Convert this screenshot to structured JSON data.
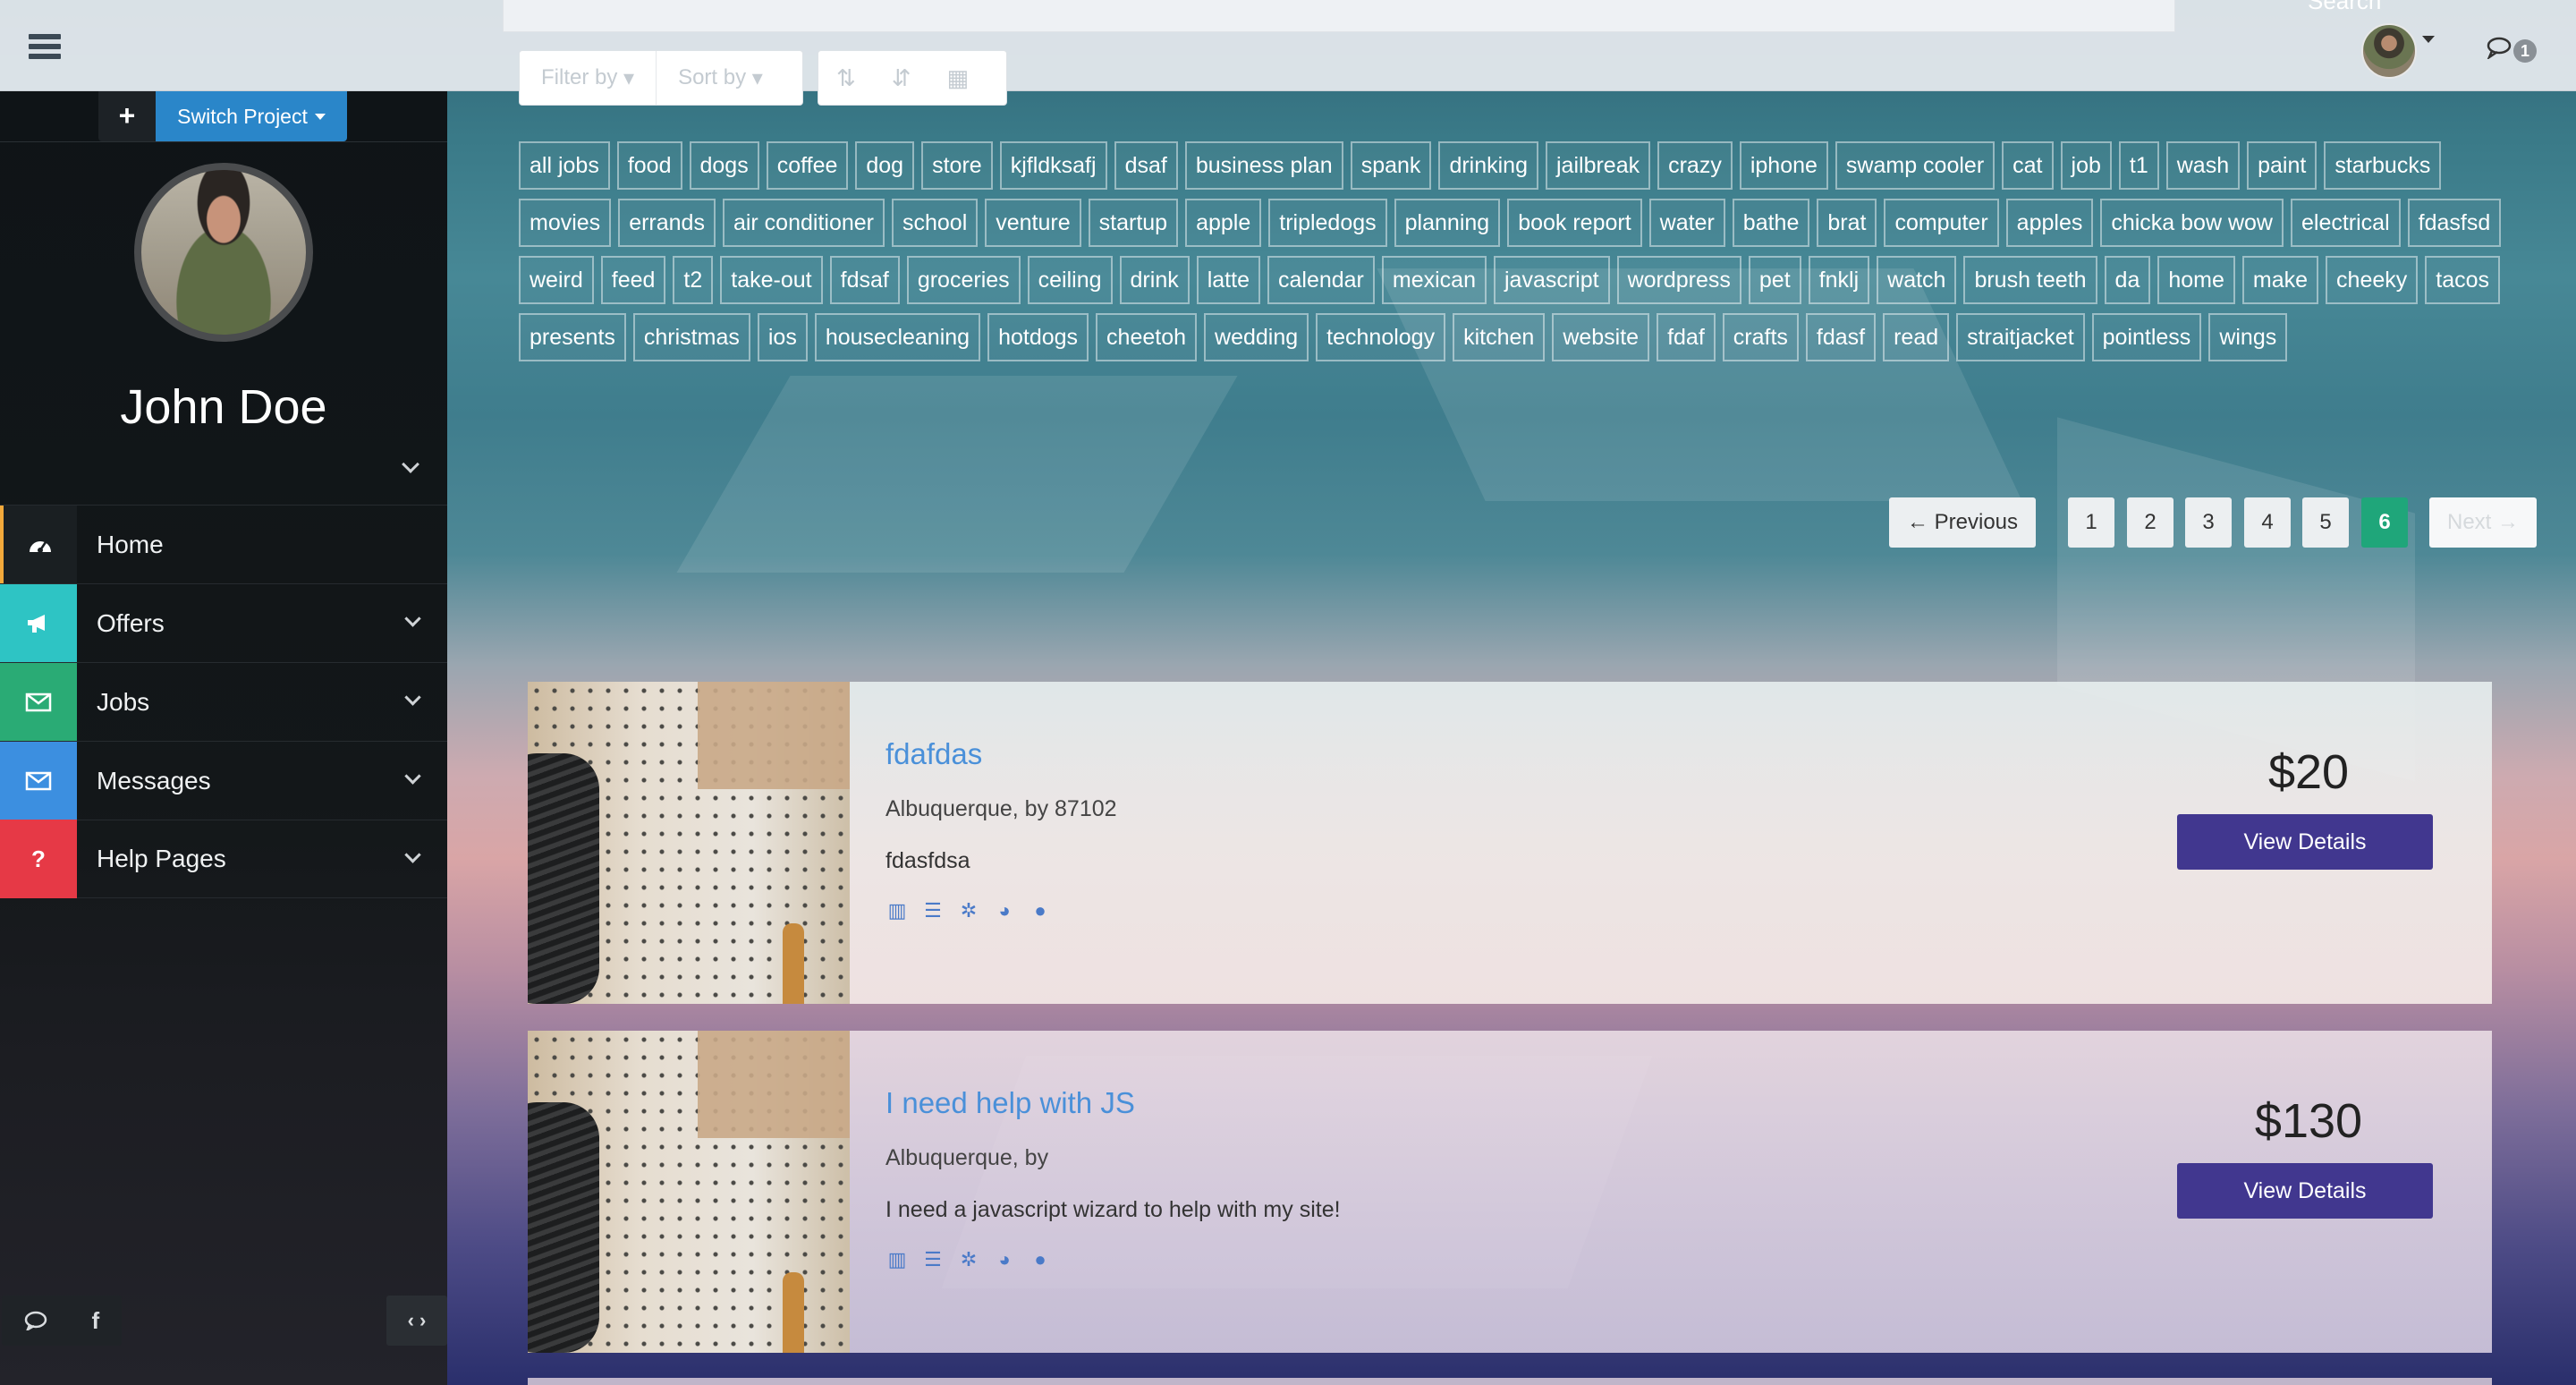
{
  "header": {
    "search_label": "Search",
    "filter_label": "Filter by",
    "sort_label": "Sort by",
    "notification_count": "1"
  },
  "sidebar": {
    "add_label": "+",
    "switch_project_label": "Switch Project",
    "user_name": "John Doe",
    "nav": [
      {
        "label": "Home",
        "icon": "dashboard-icon",
        "color": "#1a1f22",
        "accent": "#f2a93b"
      },
      {
        "label": "Offers",
        "icon": "bullhorn-icon",
        "color": "#2ec4c4"
      },
      {
        "label": "Jobs",
        "icon": "envelope-icon",
        "color": "#2aab75"
      },
      {
        "label": "Messages",
        "icon": "envelope-icon",
        "color": "#3c8fe0"
      },
      {
        "label": "Help Pages",
        "icon": "question-icon",
        "color": "#e63946"
      }
    ]
  },
  "tags": [
    "all jobs",
    "food",
    "dogs",
    "coffee",
    "dog",
    "store",
    "kjfldksafj",
    "dsaf",
    "business plan",
    "spank",
    "drinking",
    "jailbreak",
    "crazy",
    "iphone",
    "swamp cooler",
    "cat",
    "job",
    "t1",
    "wash",
    "paint",
    "starbucks",
    "movies",
    "errands",
    "air conditioner",
    "school",
    "venture",
    "startup",
    "apple",
    "tripledogs",
    "planning",
    "book report",
    "water",
    "bathe",
    "brat",
    "computer",
    "apples",
    "chicka bow wow",
    "electrical",
    "fdasfsd",
    "weird",
    "feed",
    "t2",
    "take-out",
    "fdsaf",
    "groceries",
    "ceiling",
    "drink",
    "latte",
    "calendar",
    "mexican",
    "javascript",
    "wordpress",
    "pet",
    "fnklj",
    "watch",
    "brush teeth",
    "da",
    "home",
    "make",
    "cheeky",
    "tacos",
    "presents",
    "christmas",
    "ios",
    "housecleaning",
    "hotdogs",
    "cheetoh",
    "wedding",
    "technology",
    "kitchen",
    "website",
    "fdaf",
    "crafts",
    "fdasf",
    "read",
    "straitjacket",
    "pointless",
    "wings"
  ],
  "pagination": {
    "previous": "← Previous",
    "pages": [
      "1",
      "2",
      "3",
      "4",
      "5",
      "6"
    ],
    "active_page": "6",
    "next": "Next →"
  },
  "jobs": [
    {
      "title": "fdafdas",
      "location": "Albuquerque, by 87102",
      "description": "fdasfdsa",
      "price": "$20",
      "button": "View Details"
    },
    {
      "title": "I need help with JS",
      "location": "Albuquerque, by",
      "description": "I need a javascript wizard to help with my site!",
      "price": "$130",
      "button": "View Details"
    }
  ]
}
